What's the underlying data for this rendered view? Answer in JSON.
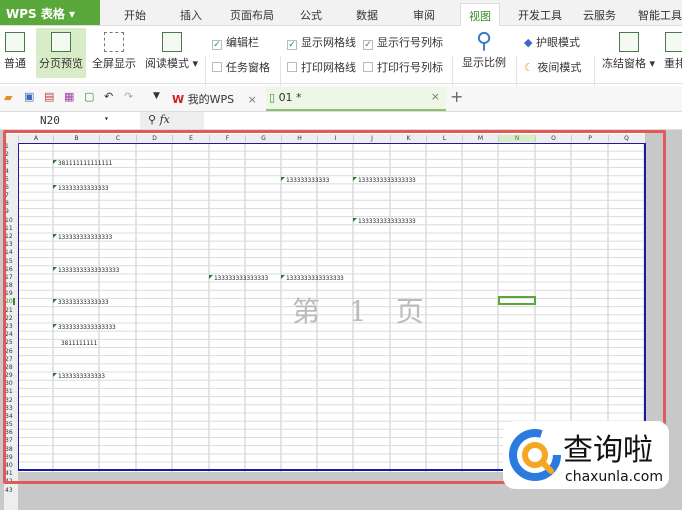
{
  "app": {
    "title": "WPS 表格",
    "menu_tabs": [
      "开始",
      "插入",
      "页面布局",
      "公式",
      "数据",
      "审阅",
      "视图",
      "开发工具",
      "云服务",
      "智能工具"
    ],
    "active_tab": "视图"
  },
  "ribbon": {
    "normal": "普通",
    "page_break": "分页预览",
    "fullscreen": "全屏显示",
    "reading": "阅读模式",
    "edit_bar": "编辑栏",
    "task_pane": "任务窗格",
    "show_grid": "显示网格线",
    "print_grid": "打印网格线",
    "show_headers": "显示行号列标",
    "print_headers": "打印行号列标",
    "zoom": "显示比例",
    "eye_protect": "护眼模式",
    "night": "夜间模式",
    "freeze": "冻结窗格",
    "rearrange": "重排"
  },
  "doc_tabs": [
    {
      "label": "我的WPS"
    },
    {
      "label": "01 *"
    }
  ],
  "formula_bar": {
    "cell_ref": "N20",
    "fx": "fx"
  },
  "columns": [
    "A",
    "B",
    "C",
    "D",
    "E",
    "F",
    "G",
    "H",
    "I",
    "J",
    "K",
    "L",
    "M",
    "N",
    "O",
    "P",
    "Q"
  ],
  "cells": [
    {
      "ref": "B3",
      "value": "381111111111111"
    },
    {
      "ref": "B6",
      "value": "13333333333333"
    },
    {
      "ref": "H5",
      "value": "133333333333"
    },
    {
      "ref": "J5",
      "value": "1333333333333333"
    },
    {
      "ref": "J10",
      "value": "1333333333333333"
    },
    {
      "ref": "B12",
      "value": "133333333333333"
    },
    {
      "ref": "B16",
      "value": "13333333333333333"
    },
    {
      "ref": "F17",
      "value": "133333333333333"
    },
    {
      "ref": "H17",
      "value": "1333333333333333"
    },
    {
      "ref": "B20",
      "value": "33333333333333"
    },
    {
      "ref": "B23",
      "value": "3333333333333333"
    },
    {
      "ref": "B25",
      "value": "3811111111",
      "plain": true
    },
    {
      "ref": "B29",
      "value": "1333333333333"
    }
  ],
  "page_label": "第 1 页",
  "selected_cell": "N20",
  "watermark": {
    "name": "查询啦",
    "url": "chaxunla.com"
  },
  "colors": {
    "accent": "#5aa83a",
    "page_border": "#1a1aa0",
    "highlight": "#e05a5a"
  }
}
